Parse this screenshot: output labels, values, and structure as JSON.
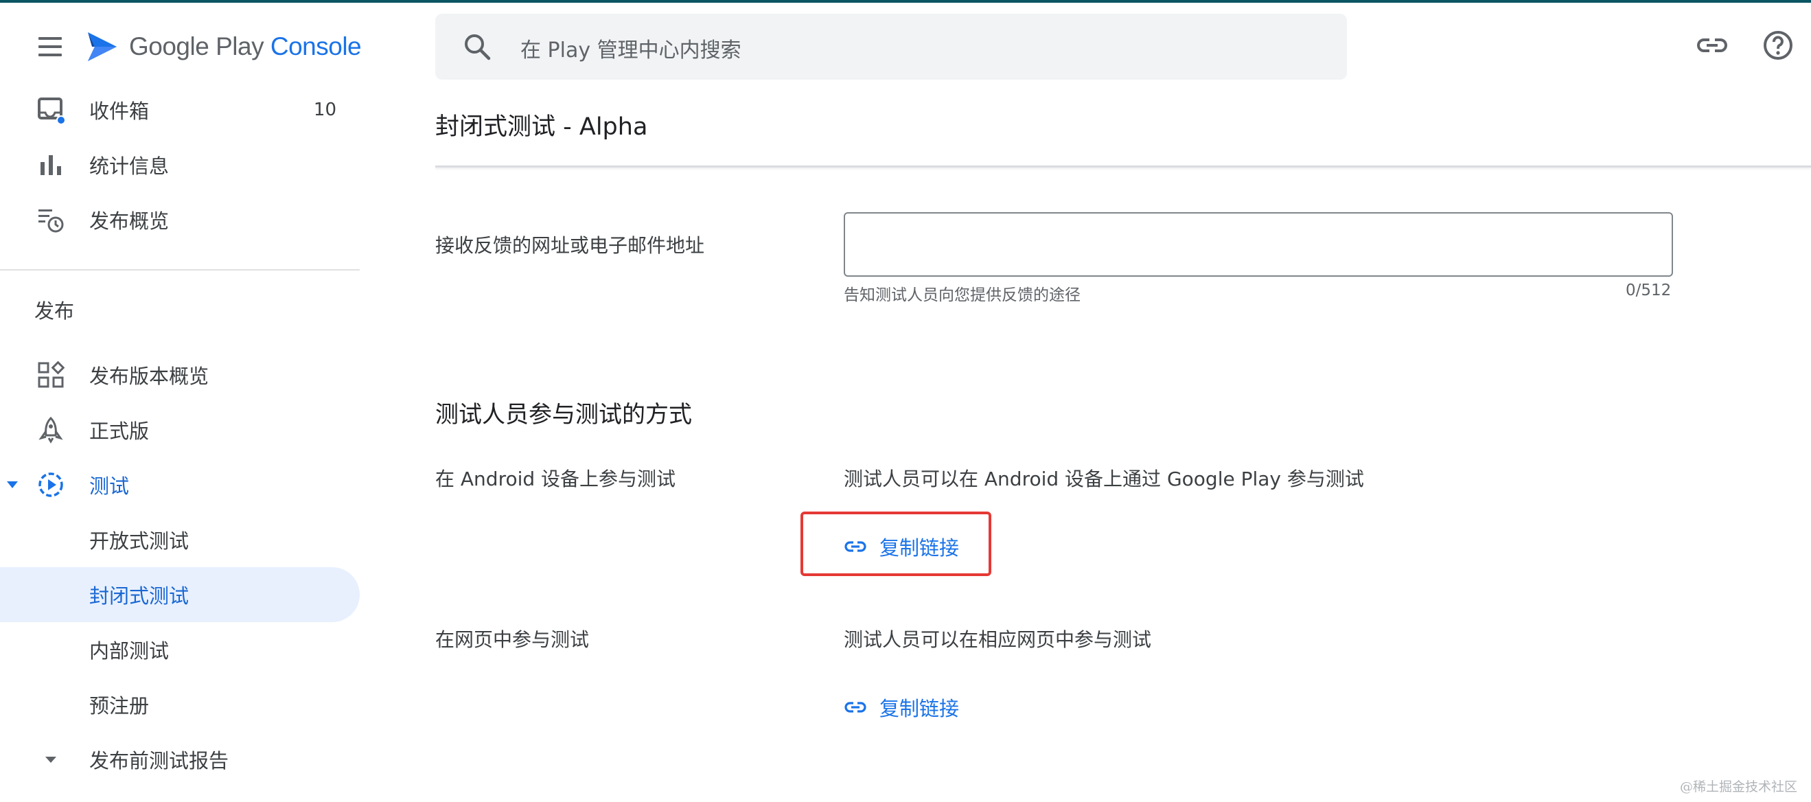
{
  "app": {
    "logo_text_main": "Google Play ",
    "logo_text_accent": "Console",
    "accent_color": "#1a73e8"
  },
  "search": {
    "placeholder": "在 Play 管理中心内搜索",
    "icon": "search-icon"
  },
  "header_icons": [
    "link-icon",
    "help-icon"
  ],
  "sidebar": {
    "top_items": [
      {
        "label": "收件箱",
        "count": "10",
        "icon": "inbox-icon"
      },
      {
        "label": "统计信息",
        "icon": "bar-chart-icon"
      },
      {
        "label": "发布概览",
        "icon": "publishing-overview-icon"
      }
    ],
    "section": "发布",
    "release_items": [
      {
        "label": "发布版本概览",
        "icon": "dashboard-icon"
      },
      {
        "label": "正式版",
        "icon": "rocket-icon"
      },
      {
        "label": "测试",
        "icon": "testing-icon",
        "expanded": true
      }
    ],
    "testing_children": [
      {
        "label": "开放式测试"
      },
      {
        "label": "封闭式测试",
        "selected": true
      },
      {
        "label": "内部测试"
      },
      {
        "label": "预注册"
      }
    ],
    "prelaunch": {
      "label": "发布前测试报告",
      "icon": "expand-more-icon"
    }
  },
  "page": {
    "title": "封闭式测试 - Alpha",
    "feedback": {
      "label": "接收反馈的网址或电子邮件地址",
      "value": "",
      "helper": "告知测试人员向您提供反馈的途径",
      "counter": "0/512"
    },
    "join_section": {
      "title": "测试人员参与测试的方式",
      "android": {
        "label": "在 Android 设备上参与测试",
        "description": "测试人员可以在 Android 设备上通过 Google Play 参与测试",
        "link_label": "复制链接"
      },
      "web": {
        "label": "在网页中参与测试",
        "description": "测试人员可以在相应网页中参与测试",
        "link_label": "复制链接"
      }
    }
  },
  "watermark": "@稀土掘金技术社区"
}
